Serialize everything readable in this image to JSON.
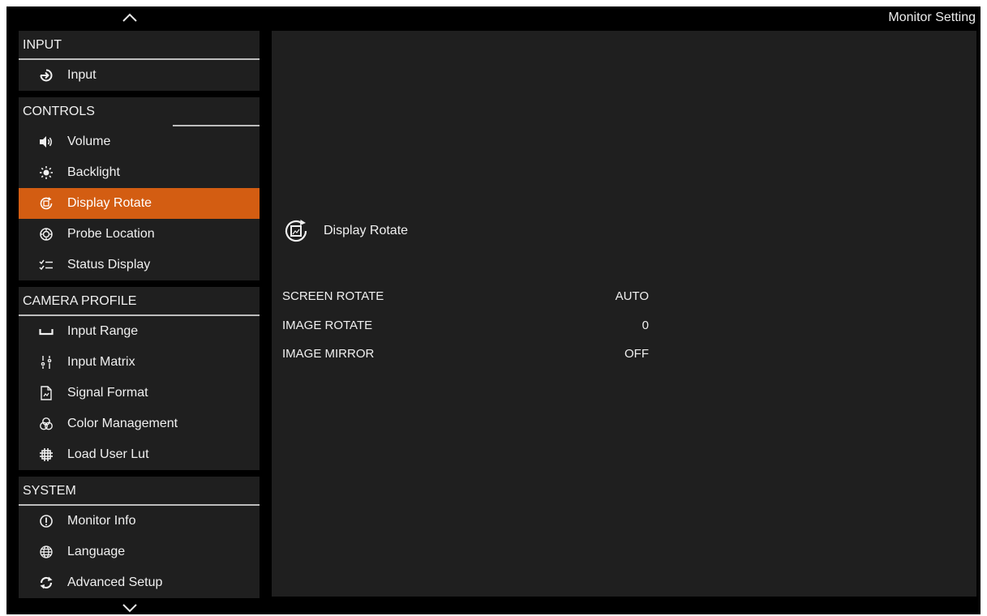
{
  "window": {
    "title": "Monitor Setting"
  },
  "sidebar": {
    "groups": [
      {
        "header": "INPUT",
        "items": [
          {
            "label": "Input",
            "icon": "input-arrow-icon"
          }
        ]
      },
      {
        "header": "CONTROLS",
        "items": [
          {
            "label": "Volume",
            "icon": "volume-icon"
          },
          {
            "label": "Backlight",
            "icon": "backlight-icon"
          },
          {
            "label": "Display Rotate",
            "icon": "display-rotate-icon",
            "active": true
          },
          {
            "label": "Probe Location",
            "icon": "probe-location-icon"
          },
          {
            "label": "Status Display",
            "icon": "status-display-icon"
          }
        ]
      },
      {
        "header": "CAMERA PROFILE",
        "items": [
          {
            "label": "Input Range",
            "icon": "input-range-icon"
          },
          {
            "label": "Input Matrix",
            "icon": "input-matrix-icon"
          },
          {
            "label": "Signal Format",
            "icon": "signal-format-icon"
          },
          {
            "label": "Color Management",
            "icon": "color-management-icon"
          },
          {
            "label": "Load User Lut",
            "icon": "load-user-lut-icon"
          }
        ]
      },
      {
        "header": "SYSTEM",
        "items": [
          {
            "label": "Monitor Info",
            "icon": "info-icon"
          },
          {
            "label": "Language",
            "icon": "globe-icon"
          },
          {
            "label": "Advanced Setup",
            "icon": "advanced-setup-icon"
          }
        ]
      }
    ]
  },
  "content": {
    "section_title": "Display Rotate",
    "section_icon": "display-rotate-icon",
    "settings": [
      {
        "label": "SCREEN ROTATE",
        "value": "AUTO"
      },
      {
        "label": "IMAGE ROTATE",
        "value": "0"
      },
      {
        "label": "IMAGE MIRROR",
        "value": "OFF"
      }
    ]
  },
  "colors": {
    "background": "#000000",
    "panel": "#1f1f1f",
    "accent": "#d35d12",
    "text": "#f0f0f0",
    "divider": "#bdbdbd"
  }
}
